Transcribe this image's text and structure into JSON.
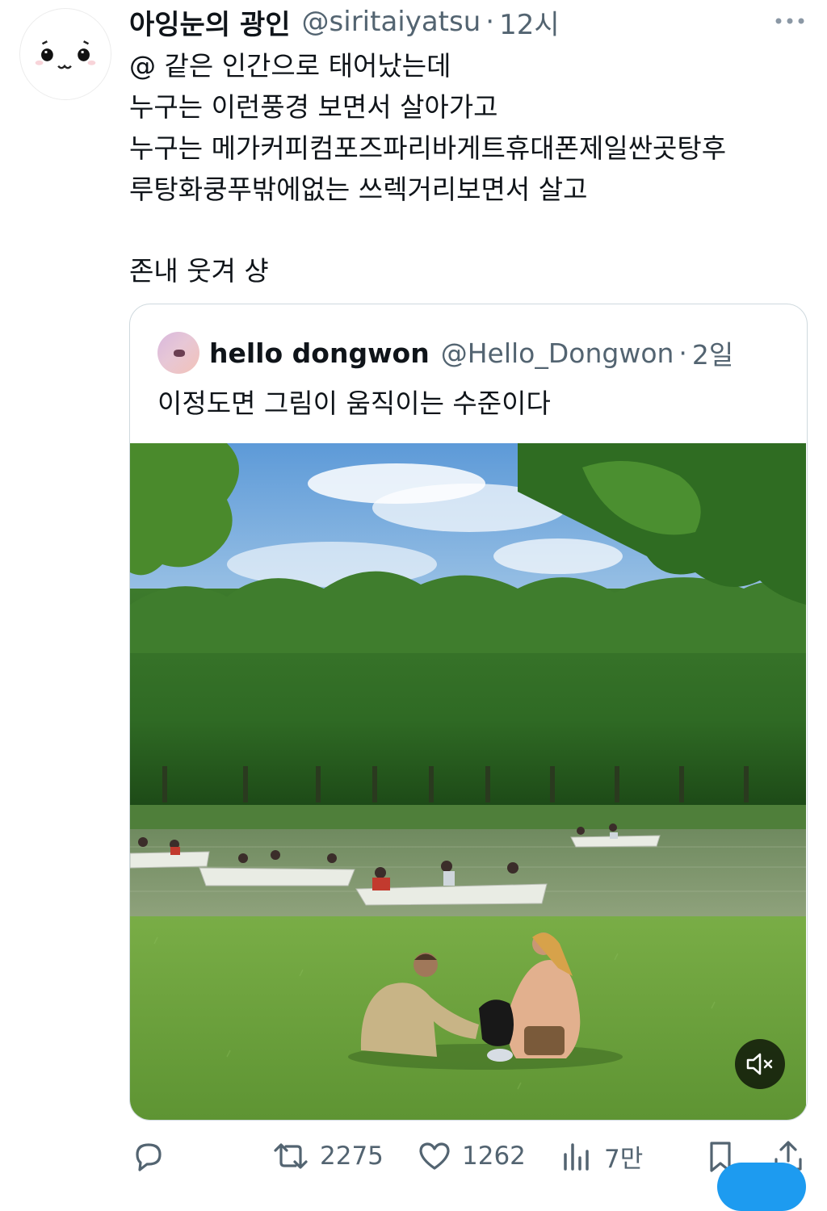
{
  "tweet": {
    "author_name": "아잉눈의 광인",
    "handle": "@siritaiyatsu",
    "separator": "·",
    "time": "12시",
    "lines": [
      "@ 같은 인간으로 태어났는데",
      "누구는 이런풍경 보면서 살아가고",
      "누구는 메가커피컴포즈파리바게트휴대폰제일싼곳탕후",
      "루탕화쿵푸밖에없는 쓰렉거리보면서 살고",
      "",
      "존내 웃겨 샹"
    ],
    "more_icon": "more-horizontal-icon"
  },
  "quote": {
    "author_name": "hello dongwon",
    "handle": "@Hello_Dongwon",
    "separator": "·",
    "time": "2일",
    "text": "이정도면 그림이 움직이는 수준이다",
    "media_icon": "speaker-muted-icon"
  },
  "actions": {
    "reply_icon": "reply-icon",
    "retweet_icon": "retweet-icon",
    "retweet_count": "2275",
    "like_icon": "heart-icon",
    "like_count": "1262",
    "views_icon": "views-bar-chart-icon",
    "views_count": "7만",
    "bookmark_icon": "bookmark-icon",
    "share_icon": "share-icon"
  },
  "colors": {
    "text": "#0f1419",
    "secondary": "#536471",
    "border": "#cfd9de",
    "accent": "#1d9bf0"
  }
}
